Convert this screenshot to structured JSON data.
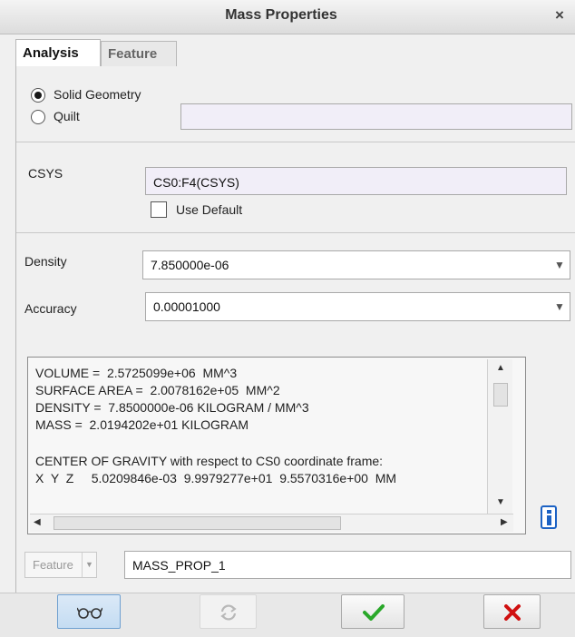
{
  "window": {
    "title": "Mass Properties",
    "close_glyph": "×"
  },
  "tabs": [
    {
      "label": "Analysis",
      "active": true
    },
    {
      "label": "Feature",
      "active": false
    }
  ],
  "geometry": {
    "options": [
      {
        "label": "Solid Geometry",
        "selected": true
      },
      {
        "label": "Quilt",
        "selected": false
      }
    ],
    "quilt_value": ""
  },
  "csys": {
    "label": "CSYS",
    "value": "CS0:F4(CSYS)",
    "use_default_label": "Use Default",
    "use_default_checked": false
  },
  "density": {
    "label": "Density",
    "value": "7.850000e-06"
  },
  "accuracy": {
    "label": "Accuracy",
    "value": "0.00001000"
  },
  "results": {
    "lines": [
      "VOLUME =  2.5725099e+06  MM^3",
      "SURFACE AREA =  2.0078162e+05  MM^2",
      "DENSITY =  7.8500000e-06 KILOGRAM / MM^3",
      "MASS =  2.0194202e+01 KILOGRAM",
      "",
      "CENTER OF GRAVITY with respect to CS0 coordinate frame:",
      "X  Y  Z     5.0209846e-03  9.9979277e+01  9.5570316e+00  MM"
    ]
  },
  "feature": {
    "label": "Feature",
    "name": "MASS_PROP_1"
  },
  "icons": {
    "info": "info-icon",
    "preview": "glasses-icon",
    "repaint": "repaint-icon",
    "ok": "checkmark-icon",
    "cancel": "cancel-icon"
  },
  "colors": {
    "ok_green": "#2aa82a",
    "cancel_red": "#d01010",
    "info_blue": "#1c62c4",
    "field_tint": "#f1eef8"
  }
}
